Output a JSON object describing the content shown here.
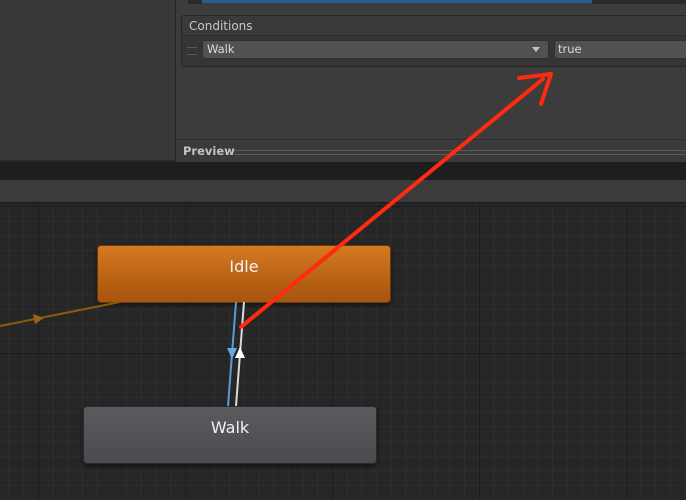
{
  "inspector": {
    "conditions_title": "Conditions",
    "condition": {
      "parameter": "Walk",
      "value": "true"
    },
    "preview_label": "Preview"
  },
  "graph": {
    "states": [
      {
        "name": "Idle",
        "color": "#c96a18",
        "is_default": true
      },
      {
        "name": "Walk",
        "color": "#505155",
        "is_default": false
      }
    ]
  },
  "colors": {
    "default_state": "#c96a18",
    "state": "#505155",
    "selected_transition": "#5b9bd5",
    "annotation_arrow": "#ff2a10",
    "entry_transition": "#8a5a10"
  },
  "annotation": {
    "type": "arrow",
    "from": "Idle-Walk transition",
    "to": "condition value field"
  }
}
